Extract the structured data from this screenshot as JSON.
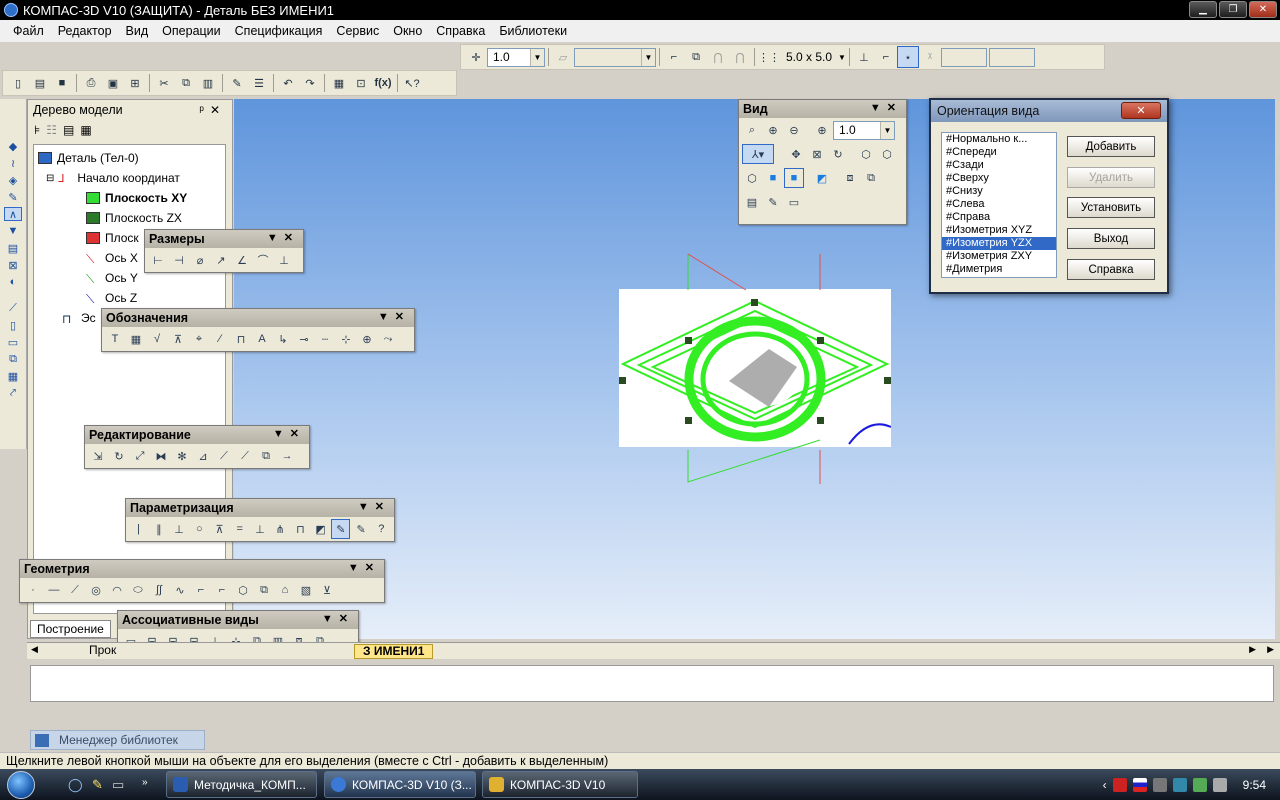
{
  "window": {
    "title": "КОМПАС-3D V10 (ЗАЩИТА) - Деталь БЕЗ ИМЕНИ1",
    "minimize": "▁",
    "restore": "❐",
    "close": "✕"
  },
  "menu": [
    "Файл",
    "Редактор",
    "Вид",
    "Операции",
    "Спецификация",
    "Сервис",
    "Окно",
    "Справка",
    "Библиотеки"
  ],
  "toolbar_top": {
    "step_value": "1.0",
    "grid_value": "5.0 x 5.0"
  },
  "tree": {
    "title": "Дерево модели",
    "root": "Деталь (Тел-0)",
    "origin": "Начало координат",
    "plane_xy": "Плоскость XY",
    "plane_zx": "Плоскость ZX",
    "plane_yz_partial": "Плоск",
    "axis_x_partial": "Ось X",
    "axis_y": "Ось Y",
    "axis_z": "Ось Z",
    "sketch_partial": "Эс",
    "tab_build": "Построение",
    "tab_process_partial": "Прок"
  },
  "panels": {
    "dimensions": "Размеры",
    "designations": "Обозначения",
    "editing": "Редактирование",
    "parametrization": "Параметризация",
    "geometry": "Геометрия",
    "assoc_views": "Ассоциативные виды",
    "view": "Вид",
    "view_zoom": "1.0"
  },
  "dialog": {
    "title": "Ориентация вида",
    "close": "✕",
    "items": [
      "#Нормально к...",
      "#Спереди",
      "#Сзади",
      "#Сверху",
      "#Снизу",
      "#Слева",
      "#Справа",
      "#Изометрия XYZ",
      "#Изометрия YZX",
      "#Изометрия ZXY",
      "#Диметрия"
    ],
    "selected_index": 8,
    "btn_add": "Добавить",
    "btn_delete": "Удалить",
    "btn_set": "Установить",
    "btn_exit": "Выход",
    "btn_help": "Справка"
  },
  "doc_tab": "З ИМЕНИ1",
  "library_manager": "Менеджер библиотек",
  "status": "Щелкните левой кнопкой мыши на объекте для его выделения (вместе с Ctrl - добавить к выделенным)",
  "taskbar": {
    "tasks": [
      "Методичка_КОМП...",
      "КОМПАС-3D V10 (З...",
      "КОМПАС-3D V10"
    ],
    "time": "9:54"
  },
  "colors": {
    "workspace_top": "#5f95dc",
    "selection": "#3169c6",
    "model_green": "#33ee22"
  }
}
